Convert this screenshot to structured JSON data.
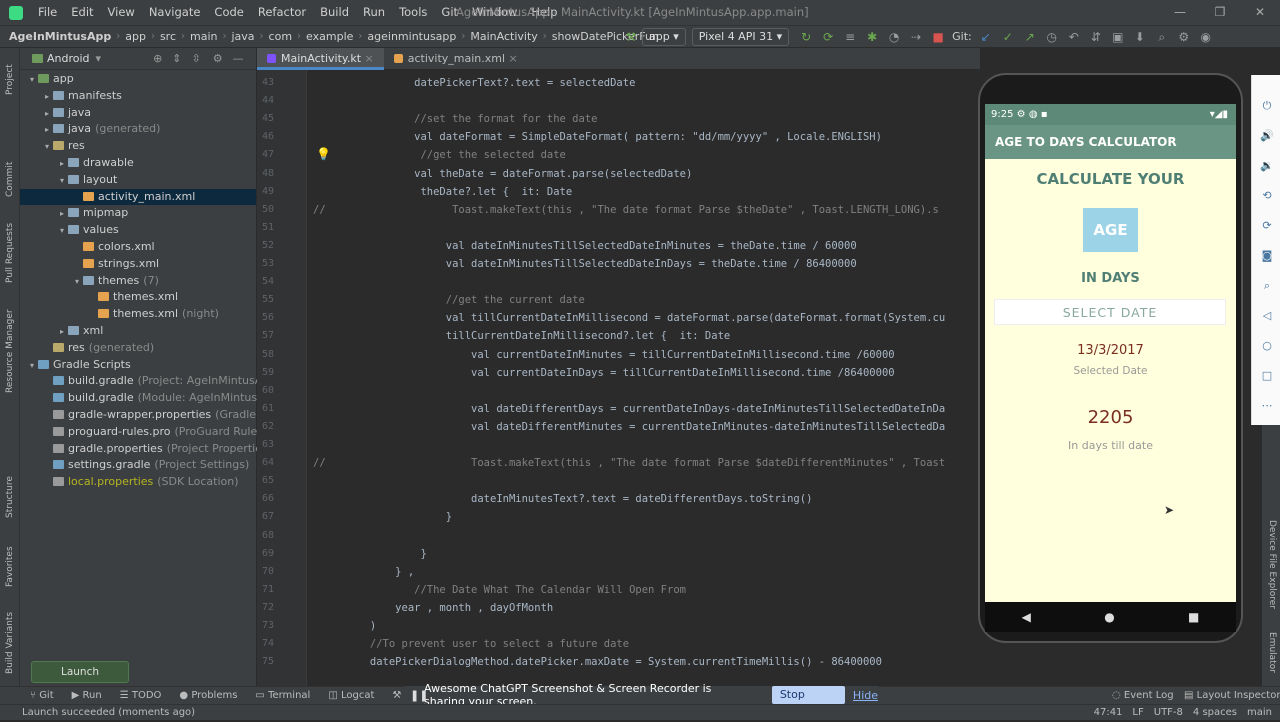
{
  "window": {
    "title": "AgeInMintusApp - MainActivity.kt [AgeInMintusApp.app.main]",
    "menu": [
      "File",
      "Edit",
      "View",
      "Navigate",
      "Code",
      "Refactor",
      "Build",
      "Run",
      "Tools",
      "Git",
      "Window",
      "Help"
    ]
  },
  "navbar": {
    "crumbs": [
      "AgeInMintusApp",
      "app",
      "src",
      "main",
      "java",
      "com",
      "example",
      "ageinmintusapp",
      "MainActivity",
      "showDatePickerFun"
    ],
    "run_config": "app",
    "device": "Pixel 4 API 31",
    "git_label": "Git:"
  },
  "project_panel": {
    "view_mode": "Android",
    "tree": [
      {
        "label": "app",
        "hint": ""
      },
      {
        "label": "manifests",
        "hint": ""
      },
      {
        "label": "java",
        "hint": ""
      },
      {
        "label": "java",
        "hint": "(generated)"
      },
      {
        "label": "res",
        "hint": ""
      },
      {
        "label": "drawable",
        "hint": ""
      },
      {
        "label": "layout",
        "hint": ""
      },
      {
        "label": "activity_main.xml",
        "hint": ""
      },
      {
        "label": "mipmap",
        "hint": ""
      },
      {
        "label": "values",
        "hint": ""
      },
      {
        "label": "colors.xml",
        "hint": ""
      },
      {
        "label": "strings.xml",
        "hint": ""
      },
      {
        "label": "themes",
        "hint": "(7)"
      },
      {
        "label": "themes.xml",
        "hint": ""
      },
      {
        "label": "themes.xml",
        "hint": "(night)"
      },
      {
        "label": "xml",
        "hint": ""
      },
      {
        "label": "res",
        "hint": "(generated)"
      },
      {
        "label": "Gradle Scripts",
        "hint": ""
      },
      {
        "label": "build.gradle",
        "hint": "(Project: AgeInMintusApp)"
      },
      {
        "label": "build.gradle",
        "hint": "(Module: AgeInMintusApp.app)"
      },
      {
        "label": "gradle-wrapper.properties",
        "hint": "(Gradle Version)"
      },
      {
        "label": "proguard-rules.pro",
        "hint": "(ProGuard Rules for Ag"
      },
      {
        "label": "gradle.properties",
        "hint": "(Project Properties)"
      },
      {
        "label": "settings.gradle",
        "hint": "(Project Settings)"
      },
      {
        "label": "local.properties",
        "hint": "(SDK Location)"
      }
    ],
    "side_tabs": [
      "Project",
      "Commit",
      "Pull Requests",
      "Resource Manager",
      "Structure",
      "Favorites",
      "Build Variants"
    ]
  },
  "editor": {
    "tabs": [
      "MainActivity.kt",
      "activity_main.xml"
    ],
    "line_numbers": [
      "43",
      "44",
      "45",
      "46",
      "47",
      "48",
      "49",
      "50",
      "51",
      "52",
      "53",
      "54",
      "55",
      "56",
      "57",
      "58",
      "59",
      "60",
      "61",
      "62",
      "63",
      "64",
      "65",
      "66",
      "67",
      "68",
      "69",
      "70",
      "71",
      "72",
      "73",
      "74",
      "75"
    ],
    "lines": [
      "                datePickerText?.text = selectedDate",
      "",
      "                //set the format for the date",
      "                val dateFormat = SimpleDateFormat( pattern: \"dd/mm/yyyy\" , Locale.ENGLISH)",
      "                 //get the selected date",
      "                val theDate = dateFormat.parse(selectedDate)",
      "                 theDate?.let {  it: Date",
      "//                    Toast.makeText(this , \"The date format Parse $theDate\" , Toast.LENGTH_LONG).s",
      "",
      "                     val dateInMinutesTillSelectedDateInMinutes = theDate.time / 60000",
      "                     val dateInMinutesTillSelectedDateInDays = theDate.time / 86400000",
      "",
      "                     //get the current date",
      "                     val tillCurrentDateInMillisecond = dateFormat.parse(dateFormat.format(System.cu",
      "                     tillCurrentDateInMillisecond?.let {  it: Date",
      "                         val currentDateInMinutes = tillCurrentDateInMillisecond.time /60000",
      "                         val currentDateInDays = tillCurrentDateInMillisecond.time /86400000",
      "",
      "                         val dateDifferentDays = currentDateInDays-dateInMinutesTillSelectedDateInDa",
      "                         val dateDifferentMinutes = currentDateInMinutes-dateInMinutesTillSelectedDa",
      "",
      "//                       Toast.makeText(this , \"The date format Parse $dateDifferentMinutes\" , Toast",
      "",
      "                         dateInMinutesText?.text = dateDifferentDays.toString()",
      "                     }",
      "",
      "                 }",
      "             } ,",
      "                //The Date What The Calendar Will Open From",
      "             year , month , dayOfMonth",
      "         )",
      "         //To prevent user to select a future date",
      "         datePickerDialogMethod.datePicker.maxDate = System.currentTimeMillis() - 86400000"
    ]
  },
  "phone": {
    "status_time": "9:25",
    "app_title": "AGE TO DAYS CALCULATOR",
    "heading": "CALCULATE YOUR",
    "age_box": "AGE",
    "in_days": "IN DAYS",
    "select_button": "SELECT DATE",
    "selected_date": "13/3/2017",
    "selected_label": "Selected Date",
    "days_value": "2205",
    "days_label": "In days till date"
  },
  "right_tabs": [
    "Device File Explorer",
    "Emulator"
  ],
  "bottom": {
    "toast": "Launch succeeded",
    "tools": [
      "Git",
      "Run",
      "TODO",
      "Problems",
      "Terminal",
      "Logcat",
      "Build"
    ],
    "share_text": "Awesome ChatGPT Screenshot & Screen Recorder is sharing your screen.",
    "stop_sharing": "Stop sharing",
    "hide": "Hide",
    "event_log": "Event Log",
    "layout_inspector": "Layout Inspector",
    "status_left": "Launch succeeded (moments ago)",
    "status_right": [
      "47:41",
      "LF",
      "UTF-8",
      "4 spaces",
      "main"
    ]
  }
}
